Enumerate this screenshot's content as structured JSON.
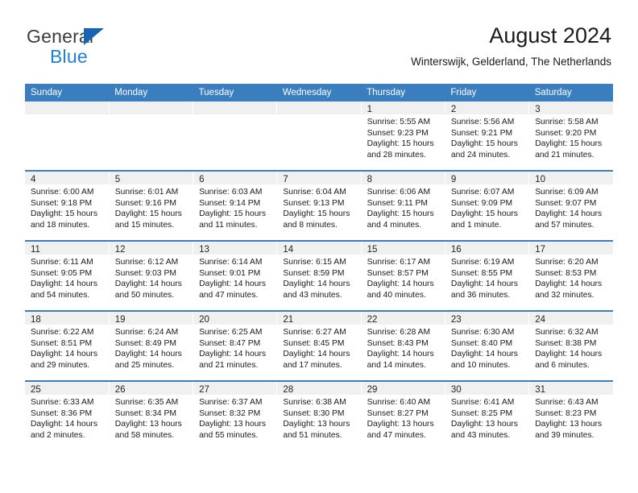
{
  "brand": {
    "name_part1": "General",
    "name_part2": "Blue",
    "triangle_color": "#1565b0",
    "blue_color": "#1f7fd4",
    "gray_color": "#3b3b3b"
  },
  "header": {
    "title": "August 2024",
    "subtitle": "Winterswijk, Gelderland, The Netherlands"
  },
  "theme": {
    "header_bar_color": "#3a7ebf",
    "daynum_band_color": "#f0f0f0",
    "row_separator_color": "#3a7ebf",
    "text_color": "#1a1a1a"
  },
  "weekday_headers": [
    "Sunday",
    "Monday",
    "Tuesday",
    "Wednesday",
    "Thursday",
    "Friday",
    "Saturday"
  ],
  "weeks": [
    [
      {
        "day": "",
        "empty": true,
        "sunrise": "",
        "sunset": "",
        "daylight_line1": "",
        "daylight_line2": ""
      },
      {
        "day": "",
        "empty": true,
        "sunrise": "",
        "sunset": "",
        "daylight_line1": "",
        "daylight_line2": ""
      },
      {
        "day": "",
        "empty": true,
        "sunrise": "",
        "sunset": "",
        "daylight_line1": "",
        "daylight_line2": ""
      },
      {
        "day": "",
        "empty": true,
        "sunrise": "",
        "sunset": "",
        "daylight_line1": "",
        "daylight_line2": ""
      },
      {
        "day": "1",
        "empty": false,
        "sunrise": "Sunrise: 5:55 AM",
        "sunset": "Sunset: 9:23 PM",
        "daylight_line1": "Daylight: 15 hours",
        "daylight_line2": "and 28 minutes."
      },
      {
        "day": "2",
        "empty": false,
        "sunrise": "Sunrise: 5:56 AM",
        "sunset": "Sunset: 9:21 PM",
        "daylight_line1": "Daylight: 15 hours",
        "daylight_line2": "and 24 minutes."
      },
      {
        "day": "3",
        "empty": false,
        "sunrise": "Sunrise: 5:58 AM",
        "sunset": "Sunset: 9:20 PM",
        "daylight_line1": "Daylight: 15 hours",
        "daylight_line2": "and 21 minutes."
      }
    ],
    [
      {
        "day": "4",
        "empty": false,
        "sunrise": "Sunrise: 6:00 AM",
        "sunset": "Sunset: 9:18 PM",
        "daylight_line1": "Daylight: 15 hours",
        "daylight_line2": "and 18 minutes."
      },
      {
        "day": "5",
        "empty": false,
        "sunrise": "Sunrise: 6:01 AM",
        "sunset": "Sunset: 9:16 PM",
        "daylight_line1": "Daylight: 15 hours",
        "daylight_line2": "and 15 minutes."
      },
      {
        "day": "6",
        "empty": false,
        "sunrise": "Sunrise: 6:03 AM",
        "sunset": "Sunset: 9:14 PM",
        "daylight_line1": "Daylight: 15 hours",
        "daylight_line2": "and 11 minutes."
      },
      {
        "day": "7",
        "empty": false,
        "sunrise": "Sunrise: 6:04 AM",
        "sunset": "Sunset: 9:13 PM",
        "daylight_line1": "Daylight: 15 hours",
        "daylight_line2": "and 8 minutes."
      },
      {
        "day": "8",
        "empty": false,
        "sunrise": "Sunrise: 6:06 AM",
        "sunset": "Sunset: 9:11 PM",
        "daylight_line1": "Daylight: 15 hours",
        "daylight_line2": "and 4 minutes."
      },
      {
        "day": "9",
        "empty": false,
        "sunrise": "Sunrise: 6:07 AM",
        "sunset": "Sunset: 9:09 PM",
        "daylight_line1": "Daylight: 15 hours",
        "daylight_line2": "and 1 minute."
      },
      {
        "day": "10",
        "empty": false,
        "sunrise": "Sunrise: 6:09 AM",
        "sunset": "Sunset: 9:07 PM",
        "daylight_line1": "Daylight: 14 hours",
        "daylight_line2": "and 57 minutes."
      }
    ],
    [
      {
        "day": "11",
        "empty": false,
        "sunrise": "Sunrise: 6:11 AM",
        "sunset": "Sunset: 9:05 PM",
        "daylight_line1": "Daylight: 14 hours",
        "daylight_line2": "and 54 minutes."
      },
      {
        "day": "12",
        "empty": false,
        "sunrise": "Sunrise: 6:12 AM",
        "sunset": "Sunset: 9:03 PM",
        "daylight_line1": "Daylight: 14 hours",
        "daylight_line2": "and 50 minutes."
      },
      {
        "day": "13",
        "empty": false,
        "sunrise": "Sunrise: 6:14 AM",
        "sunset": "Sunset: 9:01 PM",
        "daylight_line1": "Daylight: 14 hours",
        "daylight_line2": "and 47 minutes."
      },
      {
        "day": "14",
        "empty": false,
        "sunrise": "Sunrise: 6:15 AM",
        "sunset": "Sunset: 8:59 PM",
        "daylight_line1": "Daylight: 14 hours",
        "daylight_line2": "and 43 minutes."
      },
      {
        "day": "15",
        "empty": false,
        "sunrise": "Sunrise: 6:17 AM",
        "sunset": "Sunset: 8:57 PM",
        "daylight_line1": "Daylight: 14 hours",
        "daylight_line2": "and 40 minutes."
      },
      {
        "day": "16",
        "empty": false,
        "sunrise": "Sunrise: 6:19 AM",
        "sunset": "Sunset: 8:55 PM",
        "daylight_line1": "Daylight: 14 hours",
        "daylight_line2": "and 36 minutes."
      },
      {
        "day": "17",
        "empty": false,
        "sunrise": "Sunrise: 6:20 AM",
        "sunset": "Sunset: 8:53 PM",
        "daylight_line1": "Daylight: 14 hours",
        "daylight_line2": "and 32 minutes."
      }
    ],
    [
      {
        "day": "18",
        "empty": false,
        "sunrise": "Sunrise: 6:22 AM",
        "sunset": "Sunset: 8:51 PM",
        "daylight_line1": "Daylight: 14 hours",
        "daylight_line2": "and 29 minutes."
      },
      {
        "day": "19",
        "empty": false,
        "sunrise": "Sunrise: 6:24 AM",
        "sunset": "Sunset: 8:49 PM",
        "daylight_line1": "Daylight: 14 hours",
        "daylight_line2": "and 25 minutes."
      },
      {
        "day": "20",
        "empty": false,
        "sunrise": "Sunrise: 6:25 AM",
        "sunset": "Sunset: 8:47 PM",
        "daylight_line1": "Daylight: 14 hours",
        "daylight_line2": "and 21 minutes."
      },
      {
        "day": "21",
        "empty": false,
        "sunrise": "Sunrise: 6:27 AM",
        "sunset": "Sunset: 8:45 PM",
        "daylight_line1": "Daylight: 14 hours",
        "daylight_line2": "and 17 minutes."
      },
      {
        "day": "22",
        "empty": false,
        "sunrise": "Sunrise: 6:28 AM",
        "sunset": "Sunset: 8:43 PM",
        "daylight_line1": "Daylight: 14 hours",
        "daylight_line2": "and 14 minutes."
      },
      {
        "day": "23",
        "empty": false,
        "sunrise": "Sunrise: 6:30 AM",
        "sunset": "Sunset: 8:40 PM",
        "daylight_line1": "Daylight: 14 hours",
        "daylight_line2": "and 10 minutes."
      },
      {
        "day": "24",
        "empty": false,
        "sunrise": "Sunrise: 6:32 AM",
        "sunset": "Sunset: 8:38 PM",
        "daylight_line1": "Daylight: 14 hours",
        "daylight_line2": "and 6 minutes."
      }
    ],
    [
      {
        "day": "25",
        "empty": false,
        "sunrise": "Sunrise: 6:33 AM",
        "sunset": "Sunset: 8:36 PM",
        "daylight_line1": "Daylight: 14 hours",
        "daylight_line2": "and 2 minutes."
      },
      {
        "day": "26",
        "empty": false,
        "sunrise": "Sunrise: 6:35 AM",
        "sunset": "Sunset: 8:34 PM",
        "daylight_line1": "Daylight: 13 hours",
        "daylight_line2": "and 58 minutes."
      },
      {
        "day": "27",
        "empty": false,
        "sunrise": "Sunrise: 6:37 AM",
        "sunset": "Sunset: 8:32 PM",
        "daylight_line1": "Daylight: 13 hours",
        "daylight_line2": "and 55 minutes."
      },
      {
        "day": "28",
        "empty": false,
        "sunrise": "Sunrise: 6:38 AM",
        "sunset": "Sunset: 8:30 PM",
        "daylight_line1": "Daylight: 13 hours",
        "daylight_line2": "and 51 minutes."
      },
      {
        "day": "29",
        "empty": false,
        "sunrise": "Sunrise: 6:40 AM",
        "sunset": "Sunset: 8:27 PM",
        "daylight_line1": "Daylight: 13 hours",
        "daylight_line2": "and 47 minutes."
      },
      {
        "day": "30",
        "empty": false,
        "sunrise": "Sunrise: 6:41 AM",
        "sunset": "Sunset: 8:25 PM",
        "daylight_line1": "Daylight: 13 hours",
        "daylight_line2": "and 43 minutes."
      },
      {
        "day": "31",
        "empty": false,
        "sunrise": "Sunrise: 6:43 AM",
        "sunset": "Sunset: 8:23 PM",
        "daylight_line1": "Daylight: 13 hours",
        "daylight_line2": "and 39 minutes."
      }
    ]
  ]
}
